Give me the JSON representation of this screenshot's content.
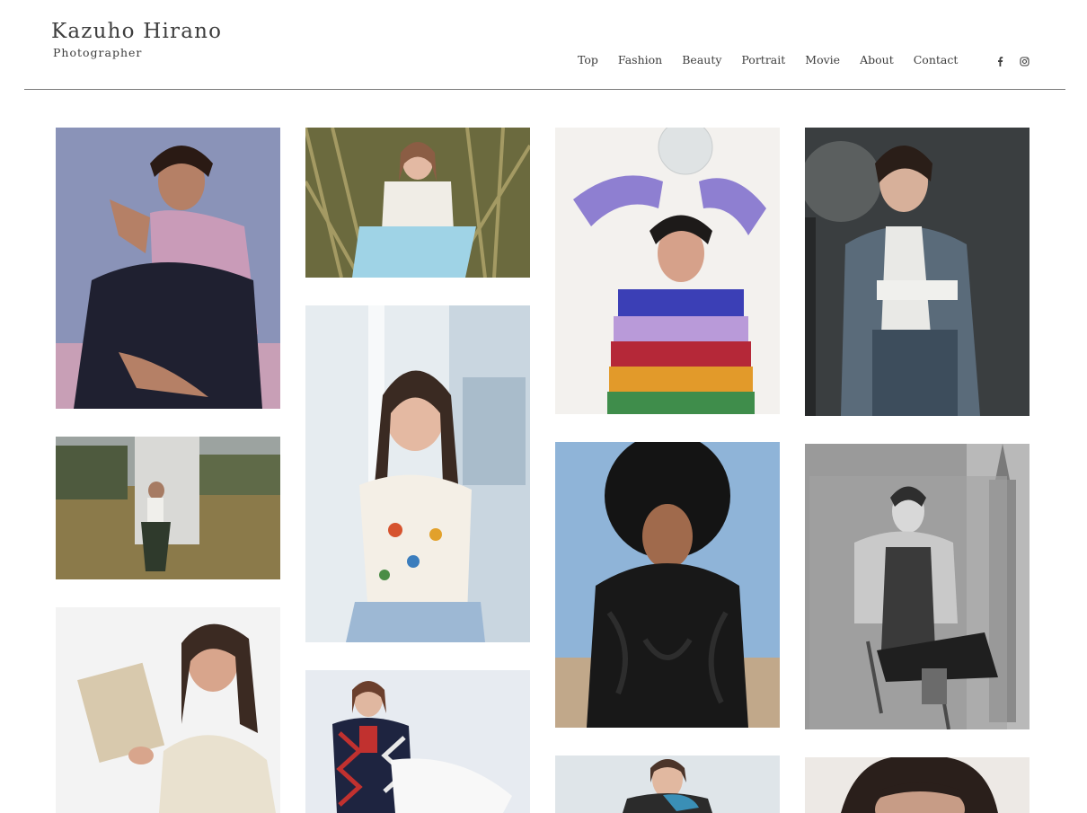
{
  "header": {
    "name": "Kazuho Hirano",
    "subtitle": "Photographer"
  },
  "nav": {
    "items": [
      "Top",
      "Fashion",
      "Beauty",
      "Portrait",
      "Movie",
      "About",
      "Contact"
    ]
  },
  "social": {
    "icons": [
      "facebook-icon",
      "instagram-icon"
    ]
  },
  "colors": {
    "text": "#3d3d3d",
    "rule": "#7a7a7a",
    "background": "#ffffff"
  },
  "gallery": {
    "photos": [
      {
        "subject": "model-pink-top",
        "palette": [
          "#8a93b8",
          "#c99bb8",
          "#1f2030"
        ]
      },
      {
        "subject": "model-grass",
        "palette": [
          "#6b6a3e",
          "#9fd3e6",
          "#f0ede6"
        ]
      },
      {
        "subject": "model-striped-sweater",
        "palette": [
          "#f3f1ee",
          "#b99ad9",
          "#3f8d4b"
        ]
      },
      {
        "subject": "model-suit",
        "palette": [
          "#3a3e40",
          "#5a6b7a",
          "#e9e9e6"
        ]
      },
      {
        "subject": "model-field",
        "palette": [
          "#8b7a4a",
          "#d9d9d6",
          "#2f3a2c"
        ]
      },
      {
        "subject": "model-window",
        "palette": [
          "#e6ecf0",
          "#f4efe6",
          "#9db8d4"
        ]
      },
      {
        "subject": "model-afro",
        "palette": [
          "#8fb4d8",
          "#141414",
          "#c1a88a"
        ]
      },
      {
        "subject": "model-monochrome",
        "palette": [
          "#9a9a9a",
          "#4a4a4a",
          "#d8d8d8"
        ]
      },
      {
        "subject": "model-book",
        "palette": [
          "#f3f3f3",
          "#d8c9ad",
          "#3b2a22"
        ]
      },
      {
        "subject": "model-coat",
        "palette": [
          "#e7ebf1",
          "#1e2440",
          "#c1312f"
        ]
      },
      {
        "subject": "model-blue-scarf",
        "palette": [
          "#dfe5e9",
          "#3a8fb6",
          "#2b2b2b"
        ]
      },
      {
        "subject": "model-closeup",
        "palette": [
          "#ede9e5",
          "#2a1f1b",
          "#c79c86"
        ]
      }
    ]
  }
}
